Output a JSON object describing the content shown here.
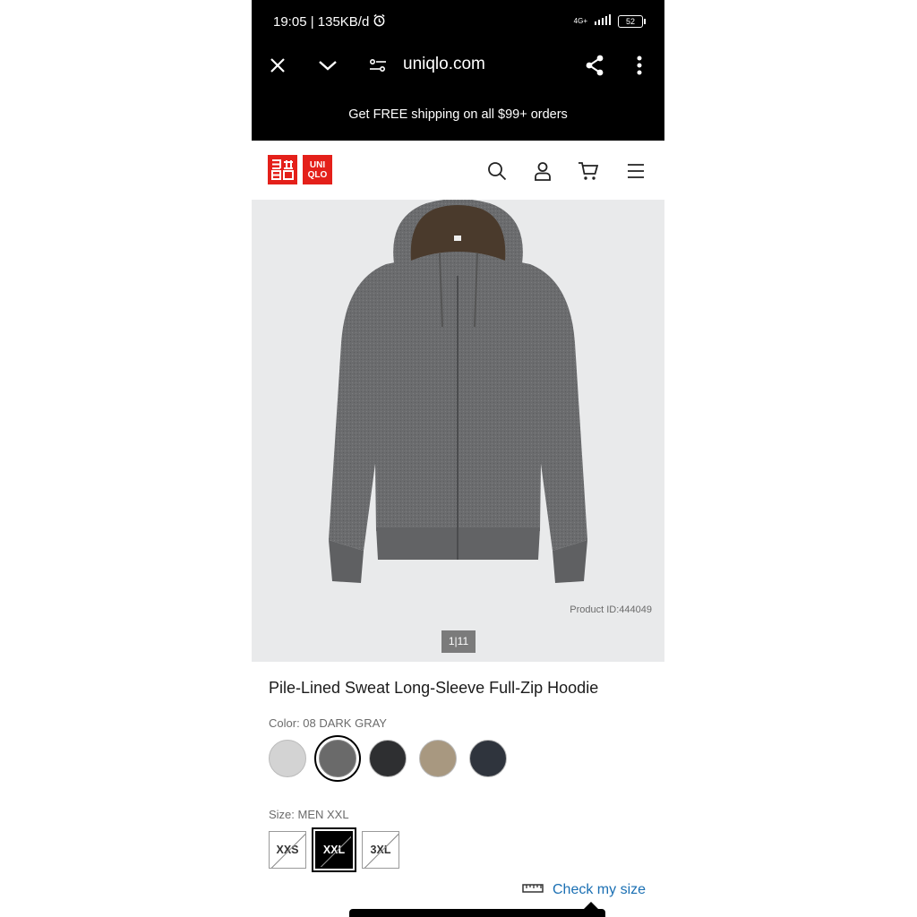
{
  "status_bar": {
    "time_speed": "19:05 | 135KB/d",
    "network": "4G+",
    "battery": "52"
  },
  "browser": {
    "url": "uniqlo.com"
  },
  "promo_banner": "Get FREE shipping on all $99+ orders",
  "brand": {
    "logo_left": "ユニ\nクロ",
    "logo_right": "UNI\nQLO",
    "color": "#e4201a"
  },
  "product": {
    "product_id": "Product ID:444049",
    "image_pager": "1|11",
    "title": "Pile-Lined Sweat Long-Sleeve Full-Zip Hoodie",
    "color_label": "Color: 08 DARK GRAY",
    "colors": [
      {
        "name": "light-gray",
        "hex": "#d3d3d3"
      },
      {
        "name": "dark-gray",
        "hex": "#6a6a6a",
        "selected": true
      },
      {
        "name": "black",
        "hex": "#2e2f31"
      },
      {
        "name": "beige",
        "hex": "#a89880"
      },
      {
        "name": "navy",
        "hex": "#2f343d"
      }
    ],
    "size_label": "Size: MEN XXL",
    "sizes": [
      {
        "label": "XXS",
        "unavailable": true
      },
      {
        "label": "XXL",
        "selected": true,
        "unavailable": true
      },
      {
        "label": "3XL",
        "unavailable": true
      }
    ],
    "check_size": "Check my size"
  },
  "icons": [
    "close-icon",
    "chevron-down-icon",
    "site-settings-icon",
    "share-icon",
    "more-vert-icon",
    "search-icon",
    "account-icon",
    "cart-icon",
    "menu-icon",
    "ruler-icon"
  ]
}
